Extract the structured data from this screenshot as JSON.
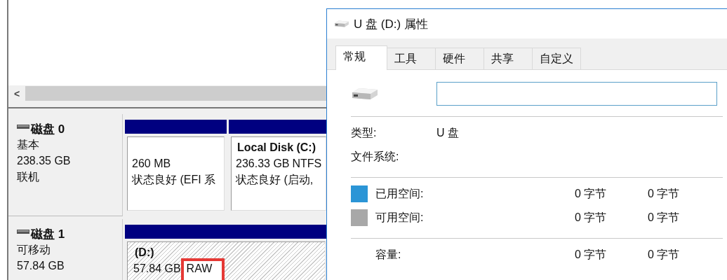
{
  "disk_manager": {
    "scroll_arrow": "<",
    "disks": [
      {
        "name": "磁盘 0",
        "type": "基本",
        "size": "238.35 GB",
        "status": "联机",
        "partitions": [
          {
            "size": "260 MB",
            "status": "状态良好 (EFI 系",
            "selected": false
          },
          {
            "label": "Local Disk  (C:)",
            "size": "236.33 GB",
            "filesystem": "NTFS",
            "status": "状态良好 (启动,",
            "selected": false,
            "highlighted": false
          }
        ]
      },
      {
        "name": "磁盘 1",
        "type": "可移动",
        "size": "57.84 GB",
        "partitions": [
          {
            "label": "(D:)",
            "size": "57.84 GB",
            "filesystem": "RAW",
            "selected": true,
            "highlighted": true
          }
        ]
      }
    ]
  },
  "dialog": {
    "title": "U 盘 (D:) 属性",
    "tabs": [
      {
        "label": "常规",
        "selected": true
      },
      {
        "label": "工具",
        "selected": false
      },
      {
        "label": "硬件",
        "selected": false
      },
      {
        "label": "共享",
        "selected": false
      },
      {
        "label": "自定义",
        "selected": false
      }
    ],
    "info": [
      {
        "label": "类型:",
        "value": "U 盘"
      },
      {
        "label": "文件系统:"
      }
    ],
    "space": [
      {
        "label": "已用空间:",
        "bytes": "0 字节",
        "size": "0 字节",
        "color": "#2b95d6"
      },
      {
        "label": "可用空间:",
        "bytes": "0 字节",
        "size": "0 字节",
        "color": "#a8a8a8"
      }
    ],
    "capacity": {
      "label": "容量:",
      "bytes": "0 字节",
      "size": "0 字节"
    }
  }
}
